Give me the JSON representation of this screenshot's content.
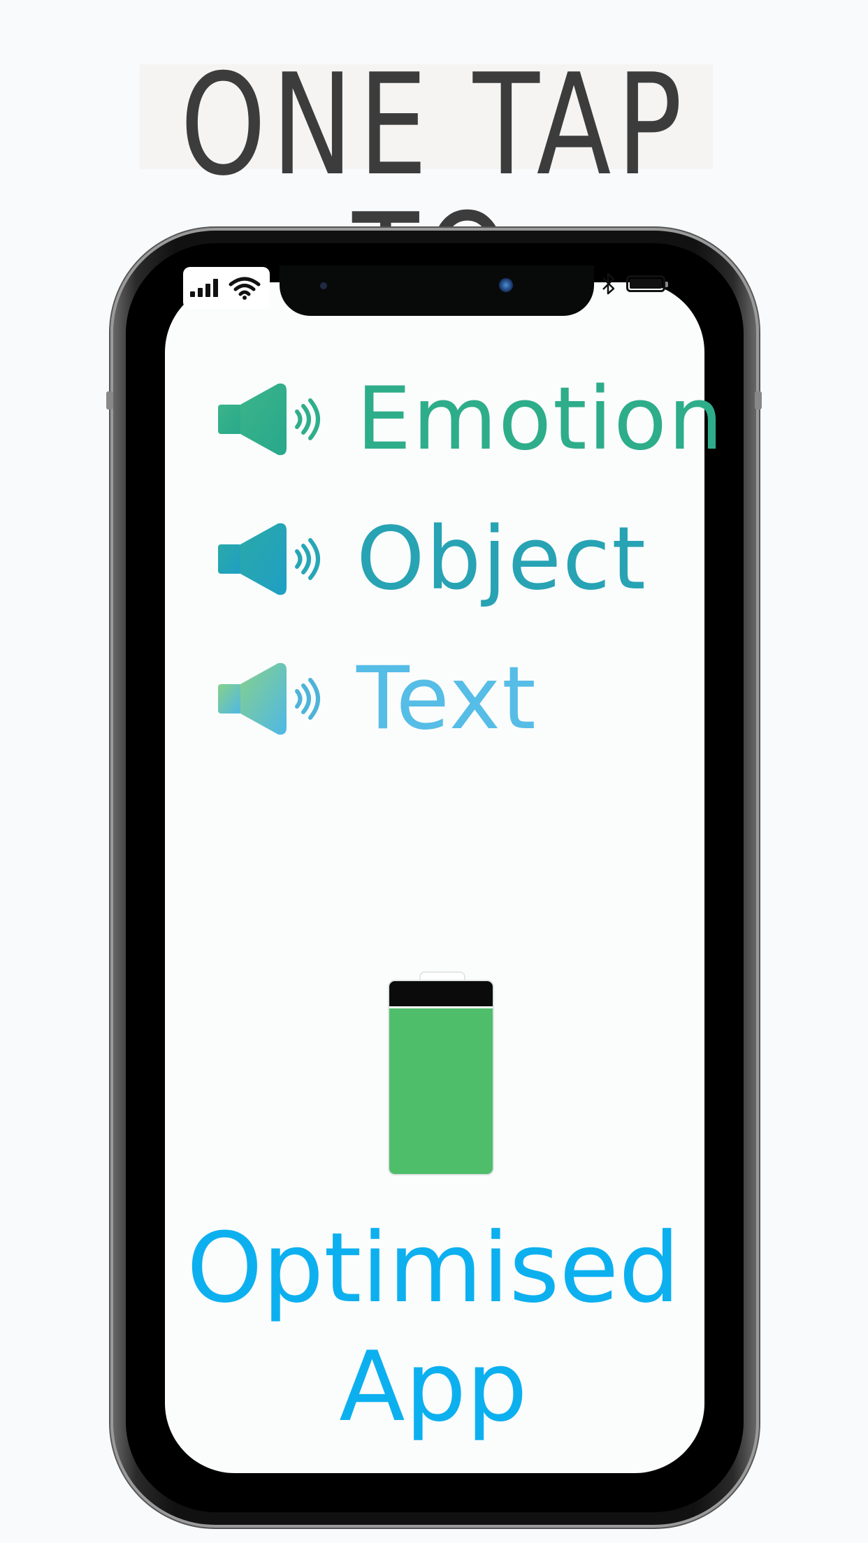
{
  "headline": "ONE TAP TO",
  "features": [
    {
      "label": "Emotion",
      "icon": "speaker-icon",
      "color": "#2ead8a"
    },
    {
      "label": "Object",
      "icon": "speaker-icon",
      "color": "#27a3b4"
    },
    {
      "label": "Text",
      "icon": "speaker-icon",
      "color": "#56bde6"
    }
  ],
  "status_bar": {
    "signal_icon": "cellular-signal-icon",
    "wifi_icon": "wifi-icon",
    "bluetooth_icon": "bluetooth-icon",
    "battery_icon": "battery-icon"
  },
  "battery_graphic": {
    "icon": "battery-level-icon",
    "level_fraction": 0.86,
    "fill_color": "#4fbe6a"
  },
  "promo": {
    "line1": "Optimised",
    "line2": "App",
    "color": "#0db0ef"
  }
}
